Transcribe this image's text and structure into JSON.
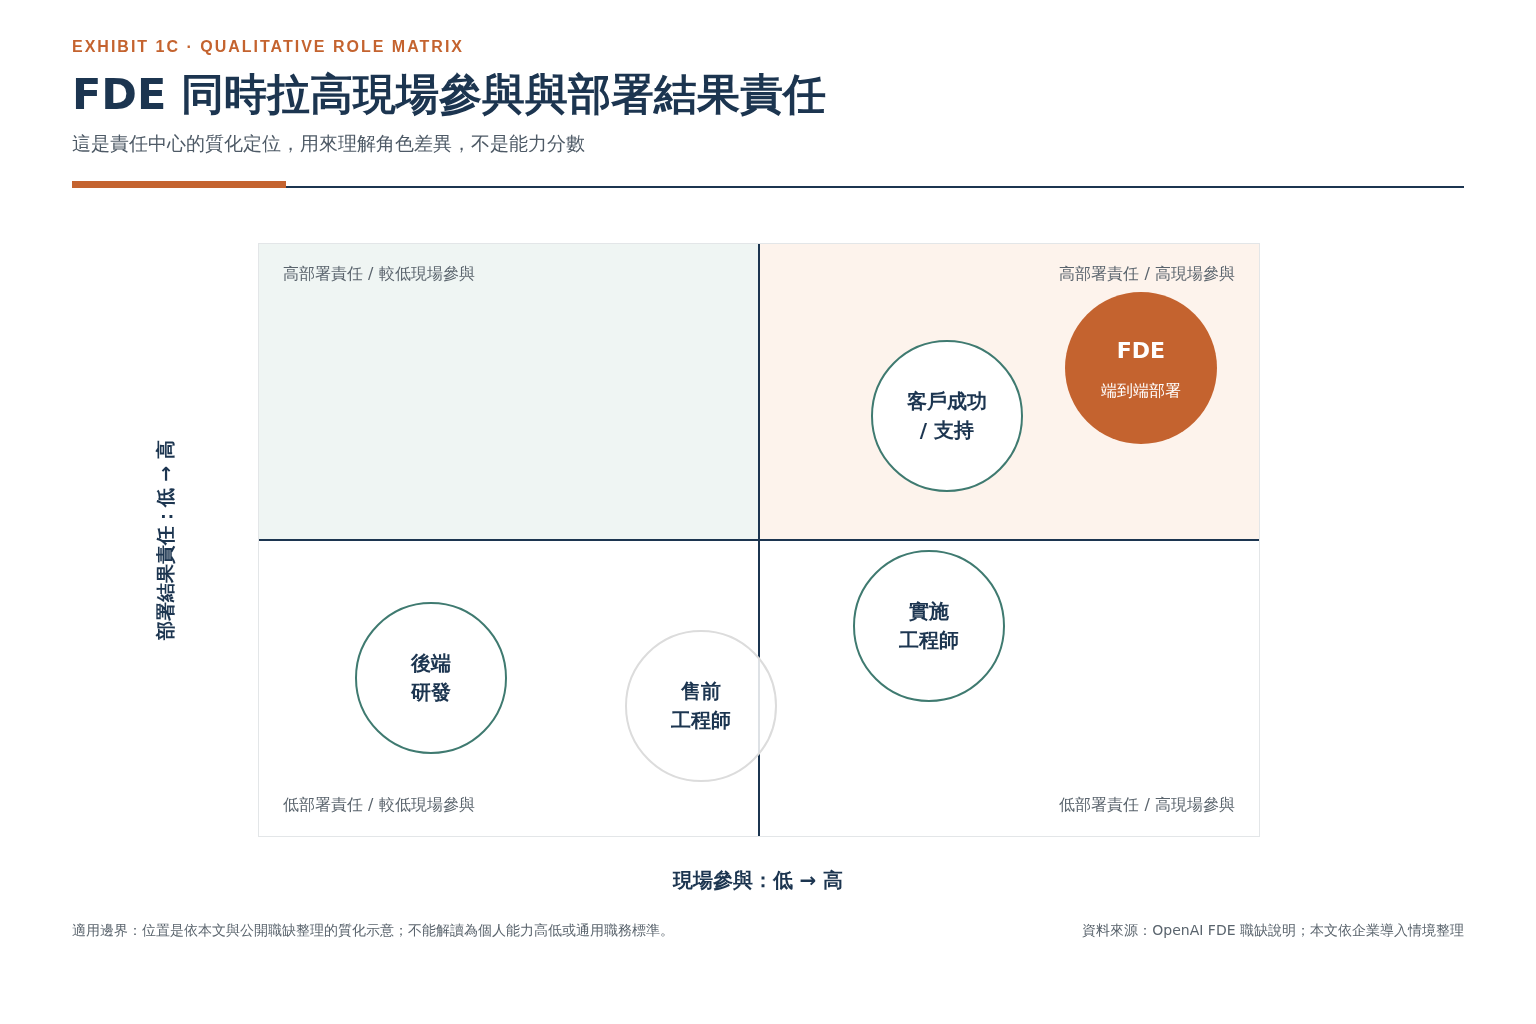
{
  "header": {
    "eyebrow": "EXHIBIT 1C · QUALITATIVE ROLE MATRIX",
    "title": "FDE 同時拉高現場參與與部署結果責任",
    "subtitle": "這是責任中心的質化定位，用來理解角色差異，不是能力分數"
  },
  "matrix": {
    "quadrants": [
      {
        "label": "高部署責任 / 較低現場參與",
        "kind": "tinted"
      },
      {
        "label": "高部署責任 / 高現場參與",
        "kind": "warm"
      },
      {
        "label": "低部署責任 / 較低現場參與",
        "kind": "plain"
      },
      {
        "label": "低部署責任 / 高現場參與",
        "kind": "plain"
      }
    ],
    "roles": [
      {
        "name": [
          "客戶成功",
          "/ 支持"
        ],
        "kind": "outlined"
      },
      {
        "name": [
          "FDE"
        ],
        "detail": "端到端部署",
        "kind": "highlight"
      },
      {
        "name": [
          "實施",
          "工程師"
        ],
        "kind": "outlined"
      },
      {
        "name": [
          "後端",
          "研發"
        ],
        "kind": "outlined"
      },
      {
        "name": [
          "售前",
          "工程師"
        ],
        "kind": "muted"
      }
    ],
    "y_axis": "部署結果責任：低 → 高",
    "x_axis": "現場參與：低 → 高"
  },
  "footer": {
    "note": "適用邊界：位置是依本文與公開職缺整理的質化示意；不能解讀為個人能力高低或通用職務標準。",
    "source": "資料來源：OpenAI FDE 職缺說明；本文依企業導入情境整理"
  }
}
